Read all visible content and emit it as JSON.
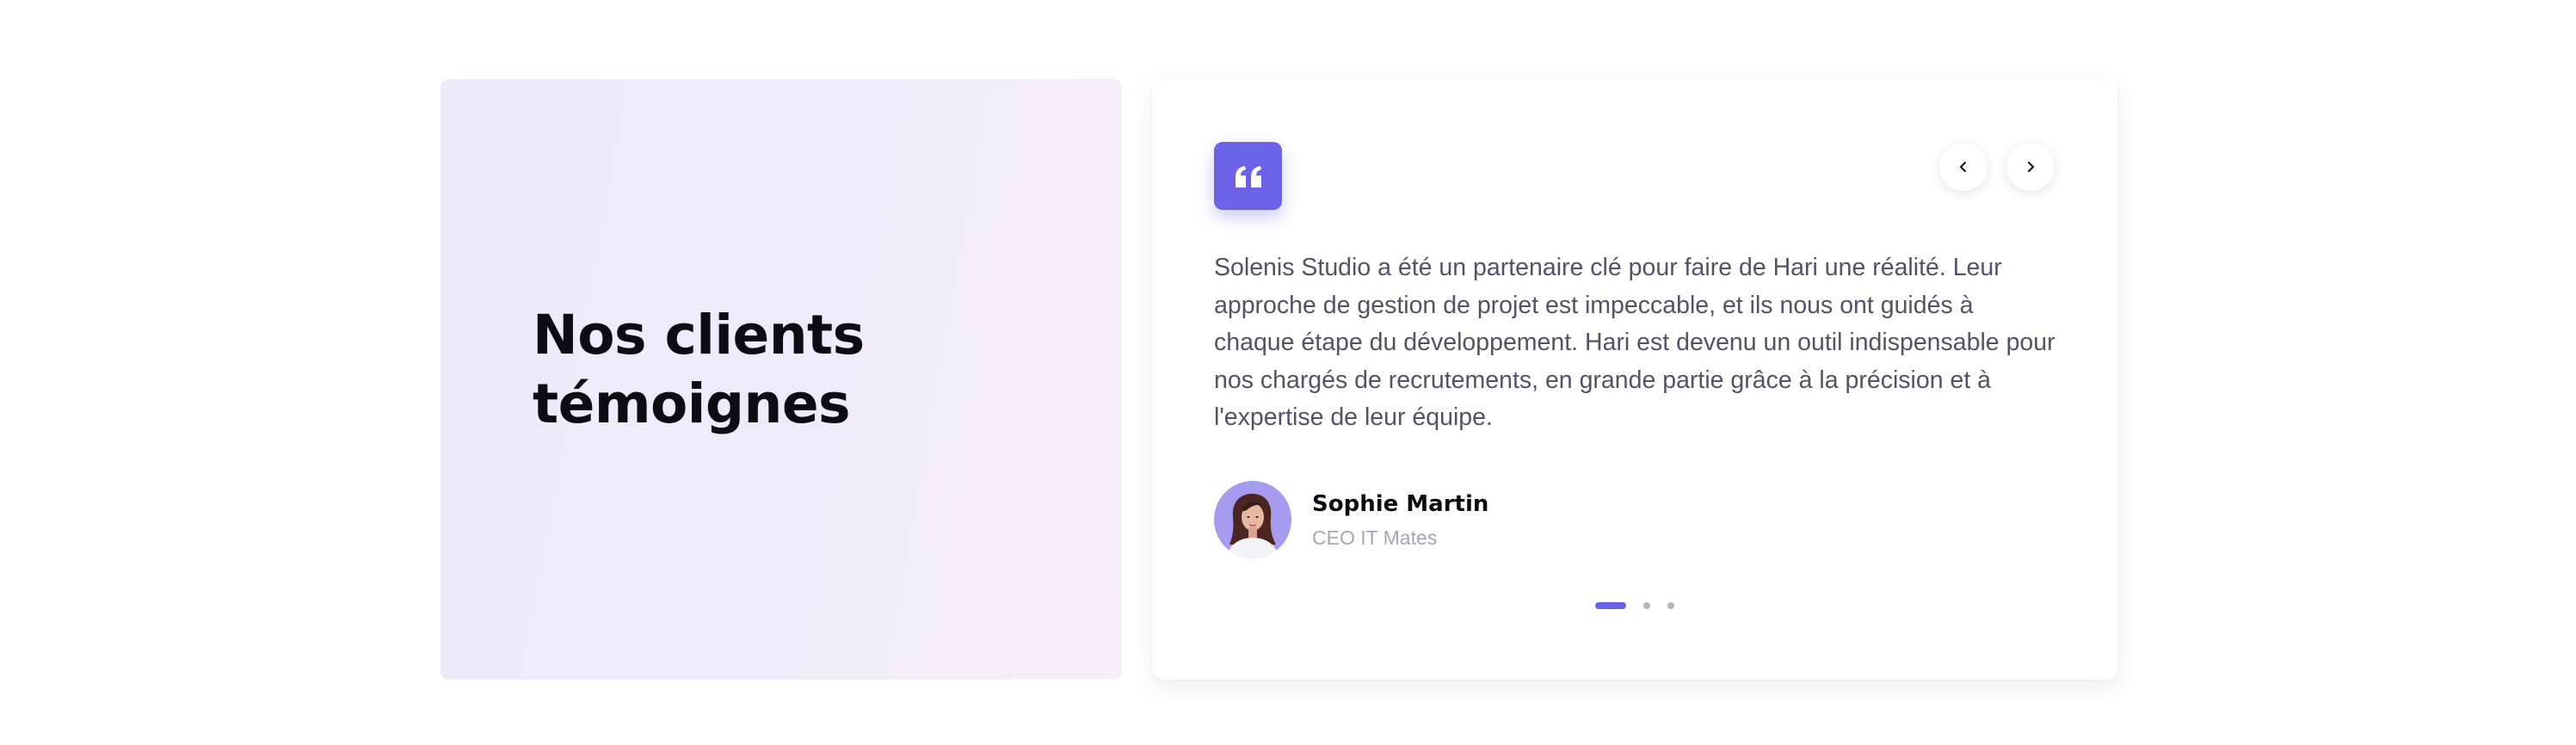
{
  "intro": {
    "title_line1": "Nos clients",
    "title_line2": "témoignes"
  },
  "testimonial": {
    "quote_icon": "quote-icon",
    "text": "Solenis Studio a été un partenaire clé pour faire de Hari une réalité. Leur approche de gestion de projet est impeccable, et ils nous ont guidés à chaque étape du développement. Hari est devenu un outil indispensable pour nos chargés de recrutements, en grande partie grâce à la précision et à l'expertise de leur équipe.",
    "author": {
      "name": "Sophie Martin",
      "role": "CEO IT Mates",
      "avatar_icon": "avatar-photo"
    }
  },
  "navigation": {
    "prev_icon": "chevron-left-icon",
    "next_icon": "chevron-right-icon"
  },
  "pagination": {
    "total": 3,
    "active_index": 0
  },
  "colors": {
    "accent": "#6b63e7",
    "heading": "#0c0c14",
    "body_text": "#505466",
    "muted_text": "#a3a6b4",
    "panel_gradient_start": "#ecebfa",
    "panel_gradient_end": "#f8ecfa"
  }
}
